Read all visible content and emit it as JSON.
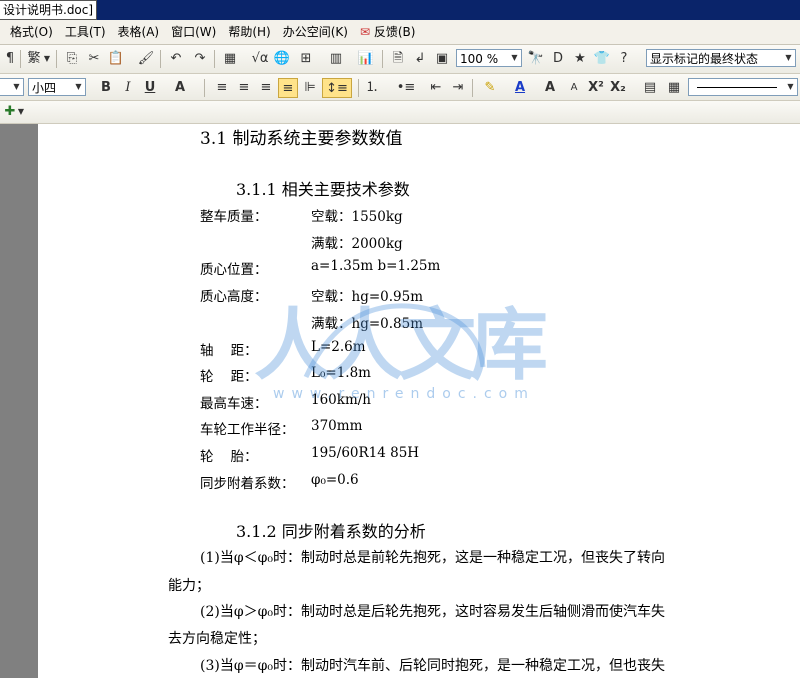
{
  "window": {
    "title": "设计说明书.doc]"
  },
  "menu": [
    "格式(O)",
    "工具(T)",
    "表格(A)",
    "窗口(W)",
    "帮助(H)",
    "办公空间(K)",
    "反馈(B)"
  ],
  "toolbar": {
    "zoom": "100 %",
    "markup_mode": "显示标记的最终状态",
    "trad_char": "繁",
    "font_size": "小四"
  },
  "document": {
    "heading": "3.1 制动系统主要参数数值",
    "section1": "3.1.1 相关主要技术参数",
    "params": [
      {
        "label": "整车质量：",
        "value": "空载：1550kg"
      },
      {
        "label": "",
        "value": "满载：2000kg"
      },
      {
        "label": "质心位置：",
        "value": "a=1.35m  b=1.25m"
      },
      {
        "label": "质心高度：",
        "value": "空载：hg=0.95m"
      },
      {
        "label": "",
        "value": "满载：hg=0.85m"
      },
      {
        "label": "轴    距：",
        "value": "L=2.6m"
      },
      {
        "label": "轮    距：",
        "value": "L₀=1.8m"
      },
      {
        "label": "最高车速：",
        "value": "160km/h"
      },
      {
        "label": "车轮工作半径：",
        "value": "370mm"
      },
      {
        "label": "轮    胎：",
        "value": "195/60R14 85H"
      },
      {
        "label": "同步附着系数：",
        "value": "φ₀=0.6"
      }
    ],
    "section2": "3.1.2 同步附着系数的分析",
    "paragraphs": [
      "(1)当φ＜φ₀时：制动时总是前轮先抱死，这是一种稳定工况，但丧失了转向",
      "能力；",
      "(2)当φ＞φ₀时：制动时总是后轮先抱死，这时容易发生后轴侧滑而使汽车失",
      "去方向稳定性；",
      "(3)当φ＝φ₀时：制动时汽车前、后轮同时抱死，是一种稳定工况，但也丧失"
    ]
  },
  "watermark": {
    "text": "人人文库",
    "url": "www.renrendoc.com"
  },
  "colors": {
    "watermark": "#4a90d9",
    "titlebar": "#0a246a"
  }
}
